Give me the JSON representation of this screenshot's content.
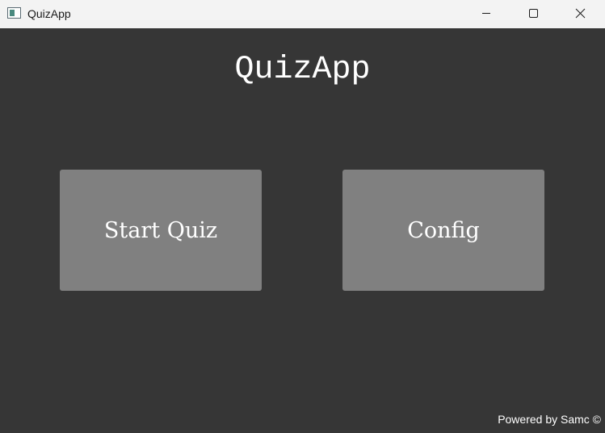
{
  "window": {
    "title": "QuizApp",
    "icon": "app-window-icon",
    "controls": [
      "minimize-icon",
      "maximize-icon",
      "close-icon"
    ]
  },
  "main": {
    "heading": "QuizApp",
    "start_label": "Start Quiz",
    "config_label": "Config",
    "footer": "Powered by Samc ©"
  },
  "colors": {
    "background": "#363636",
    "button": "#808080",
    "titlebar": "#f3f3f3",
    "text": "#ffffff"
  }
}
